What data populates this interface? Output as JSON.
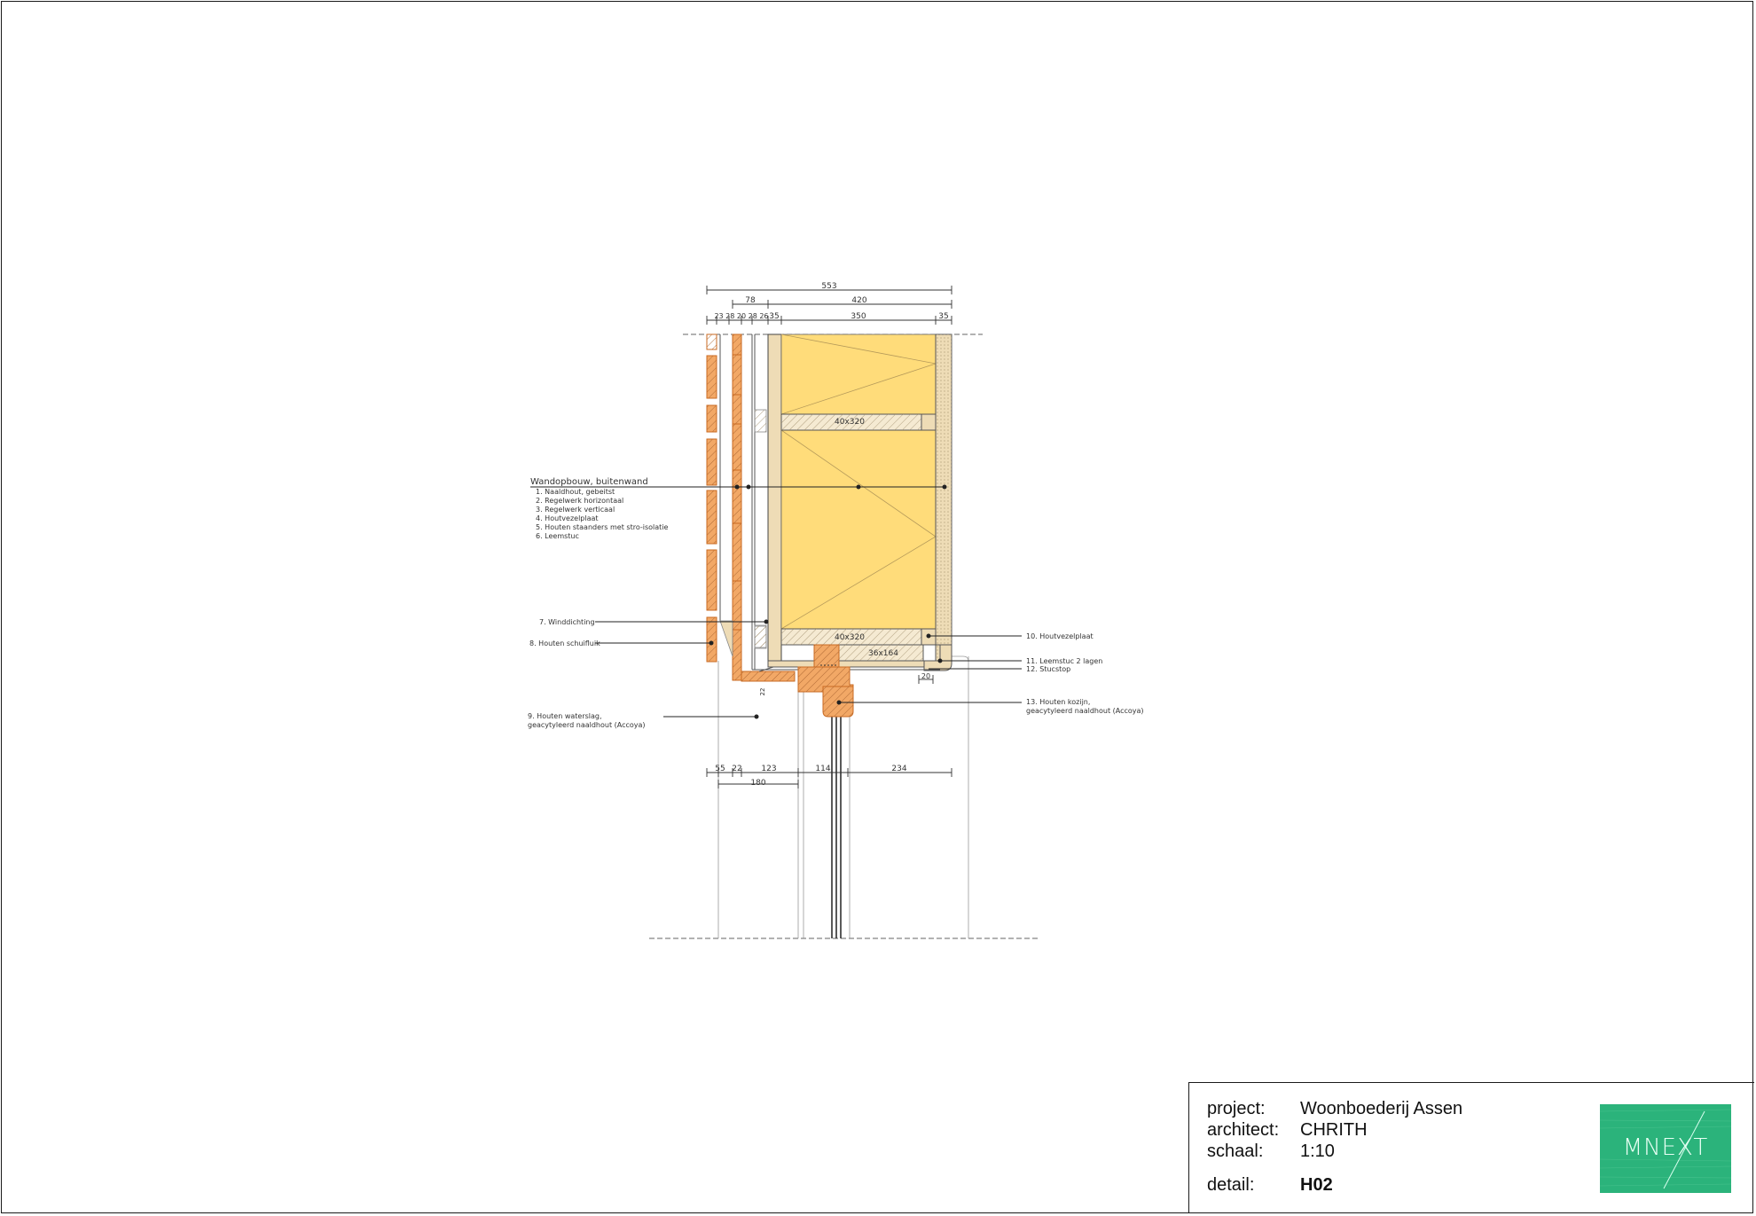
{
  "drawing": {
    "dims_top": {
      "total": "553",
      "d78": "78",
      "d420": "420",
      "small": "23 28 20 28 26",
      "d35a": "35",
      "d350": "350",
      "d35b": "35"
    },
    "dims_bottom": {
      "d55": "55",
      "d22": "22",
      "d123": "123",
      "d114": "114",
      "d234": "234",
      "d180": "180"
    },
    "beams": {
      "upper": "40x320",
      "lower": "40x320",
      "sill": "36x164"
    },
    "small_labels": {
      "side": "22",
      "stucstop": "20"
    },
    "wall_legend": {
      "title": "Wandopbouw, buitenwand",
      "items": [
        "1.   Naaldhout, gebeitst",
        "2.   Regelwerk horizontaal",
        "3.   Regelwerk verticaal",
        "4.   Houtvezelplaat",
        "5.   Houten staanders met stro-isolatie",
        "6.   Leemstuc"
      ]
    },
    "callouts": {
      "c7": "7.  Winddichting",
      "c8": "8.  Houten schuifluik",
      "c9a": "9.  Houten waterslag,",
      "c9b": "geacytyleerd naaldhout (Accoya)",
      "c10": "10.  Houtvezelplaat",
      "c11": "11.  Leemstuc 2 lagen",
      "c12": "12.  Stucstop",
      "c13a": "13.  Houten kozijn,",
      "c13b": "geacytyleerd naaldhout (Accoya)"
    }
  },
  "title_block": {
    "project_label": "project:",
    "project_value": "Woonboederij Assen",
    "architect_label": "architect:",
    "architect_value": "CHRITH",
    "scale_label": "schaal:",
    "scale_value": "1:10",
    "detail_label": "detail:",
    "detail_value": "H02",
    "logo_text": "MNEXT"
  },
  "colors": {
    "insulation": "#ffdc7a",
    "timber": "#f2a866",
    "timber_edge": "#c96a22",
    "board": "#eedcb6",
    "line": "#333333"
  }
}
